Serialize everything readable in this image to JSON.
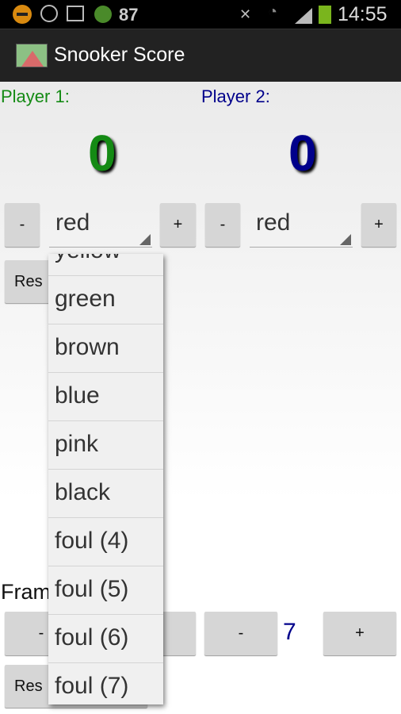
{
  "status_bar": {
    "battery_level_text": "87",
    "time": "14:55",
    "icons": [
      "dnd-icon",
      "alarm-icon",
      "image-icon",
      "activity-icon",
      "mute-icon",
      "wifi-icon",
      "signal-icon",
      "battery-icon"
    ]
  },
  "app": {
    "title": "Snooker Score"
  },
  "player1": {
    "label": "Player 1:",
    "score": "0",
    "ball": "red",
    "minus": "-",
    "plus": "+",
    "color": "#148a14"
  },
  "player2": {
    "label": "Player 2:",
    "score": "0",
    "ball": "red",
    "minus": "-",
    "plus": "+",
    "color": "#00008b"
  },
  "reset_label": "Res",
  "frames": {
    "label": "Fram",
    "minus1": "-",
    "plus1": "+",
    "minus2": "-",
    "value": "7",
    "plus2": "+",
    "reset_label": "Res"
  },
  "dropdown": {
    "options": [
      "yellow",
      "green",
      "brown",
      "blue",
      "pink",
      "black",
      "foul (4)",
      "foul (5)",
      "foul (6)",
      "foul (7)"
    ]
  }
}
